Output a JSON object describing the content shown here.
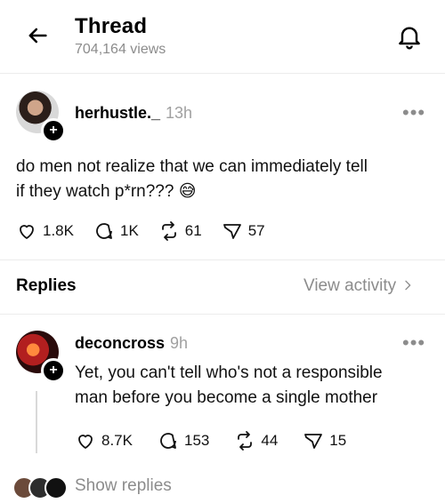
{
  "header": {
    "title": "Thread",
    "views": "704,164 views"
  },
  "post": {
    "username": "herhustle._",
    "time": "13h",
    "text_line1": "do men not realize that we can immediately tell",
    "text_line2": "if they watch p*rn??? 😅",
    "likes": "1.8K",
    "comments": "1K",
    "reposts": "61",
    "shares": "57"
  },
  "replies_section": {
    "label": "Replies",
    "view_activity": "View activity"
  },
  "reply": {
    "username": "deconcross",
    "time": "9h",
    "text_line1": "Yet, you can't tell who's not a responsible",
    "text_line2": "man before you become a single mother",
    "likes": "8.7K",
    "comments": "153",
    "reposts": "44",
    "shares": "15",
    "show_replies": "Show replies"
  },
  "more_glyph": "•••",
  "colors": {
    "muted": "#8c8c8c",
    "divider": "#ececec"
  }
}
